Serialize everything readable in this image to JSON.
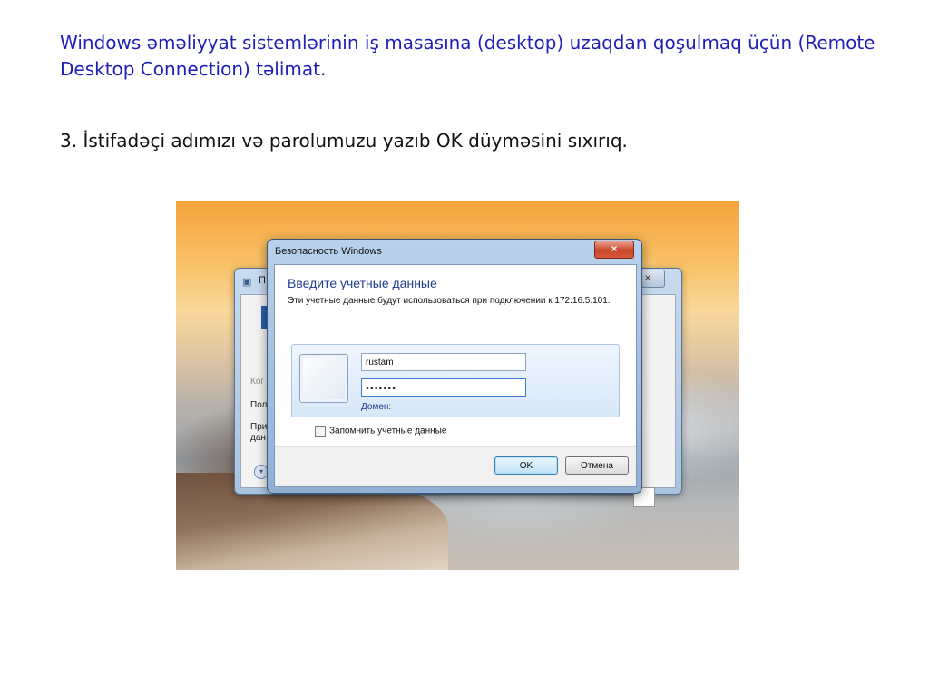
{
  "slide": {
    "title": "Windows əməliyyat sistemlərinin iş masasına (desktop) uzaqdan qoşulmaq üçün (Remote Desktop Connection) təlimat.",
    "step": "3. İstifadəçi adımızı və parolumuzu yazıb OK düyməsini sıxırıq."
  },
  "back_window": {
    "title_fragment": "П",
    "close_glyph": "×",
    "fragments": [
      "Ког",
      "Пол",
      "При",
      "дан"
    ]
  },
  "dialog": {
    "title": "Безопасность Windows",
    "close_glyph": "×",
    "heading": "Введите учетные данные",
    "description": "Эти учетные данные будут использоваться при подключении к 172.16.5.101.",
    "username": "rustam",
    "password_mask": "•••••••",
    "domain_label": "Домен:",
    "remember_label": "Запомнить учетные данные",
    "ok_label": "OK",
    "cancel_label": "Отмена"
  }
}
